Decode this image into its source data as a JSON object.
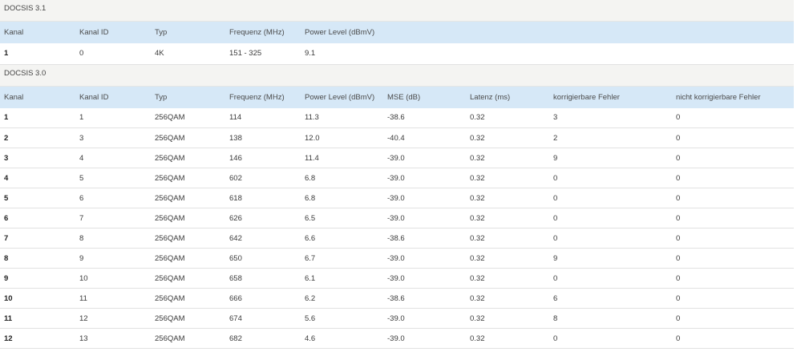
{
  "d31": {
    "title": "DOCSIS 3.1",
    "headers": [
      "Kanal",
      "Kanal ID",
      "Typ",
      "Frequenz (MHz)",
      "Power Level (dBmV)"
    ],
    "rows": [
      [
        "1",
        "0",
        "4K",
        "151 - 325",
        "9.1"
      ]
    ]
  },
  "d30": {
    "title": "DOCSIS 3.0",
    "headers": [
      "Kanal",
      "Kanal ID",
      "Typ",
      "Frequenz (MHz)",
      "Power Level (dBmV)",
      "MSE (dB)",
      "Latenz (ms)",
      "korrigierbare Fehler",
      "nicht korrigierbare Fehler"
    ],
    "rows": [
      [
        "1",
        "1",
        "256QAM",
        "114",
        "11.3",
        "-38.6",
        "0.32",
        "3",
        "0"
      ],
      [
        "2",
        "3",
        "256QAM",
        "138",
        "12.0",
        "-40.4",
        "0.32",
        "2",
        "0"
      ],
      [
        "3",
        "4",
        "256QAM",
        "146",
        "11.4",
        "-39.0",
        "0.32",
        "9",
        "0"
      ],
      [
        "4",
        "5",
        "256QAM",
        "602",
        "6.8",
        "-39.0",
        "0.32",
        "0",
        "0"
      ],
      [
        "5",
        "6",
        "256QAM",
        "618",
        "6.8",
        "-39.0",
        "0.32",
        "0",
        "0"
      ],
      [
        "6",
        "7",
        "256QAM",
        "626",
        "6.5",
        "-39.0",
        "0.32",
        "0",
        "0"
      ],
      [
        "7",
        "8",
        "256QAM",
        "642",
        "6.6",
        "-38.6",
        "0.32",
        "0",
        "0"
      ],
      [
        "8",
        "9",
        "256QAM",
        "650",
        "6.7",
        "-39.0",
        "0.32",
        "9",
        "0"
      ],
      [
        "9",
        "10",
        "256QAM",
        "658",
        "6.1",
        "-39.0",
        "0.32",
        "0",
        "0"
      ],
      [
        "10",
        "11",
        "256QAM",
        "666",
        "6.2",
        "-38.6",
        "0.32",
        "6",
        "0"
      ],
      [
        "11",
        "12",
        "256QAM",
        "674",
        "5.6",
        "-39.0",
        "0.32",
        "8",
        "0"
      ],
      [
        "12",
        "13",
        "256QAM",
        "682",
        "4.6",
        "-39.0",
        "0.32",
        "0",
        "0"
      ]
    ]
  }
}
